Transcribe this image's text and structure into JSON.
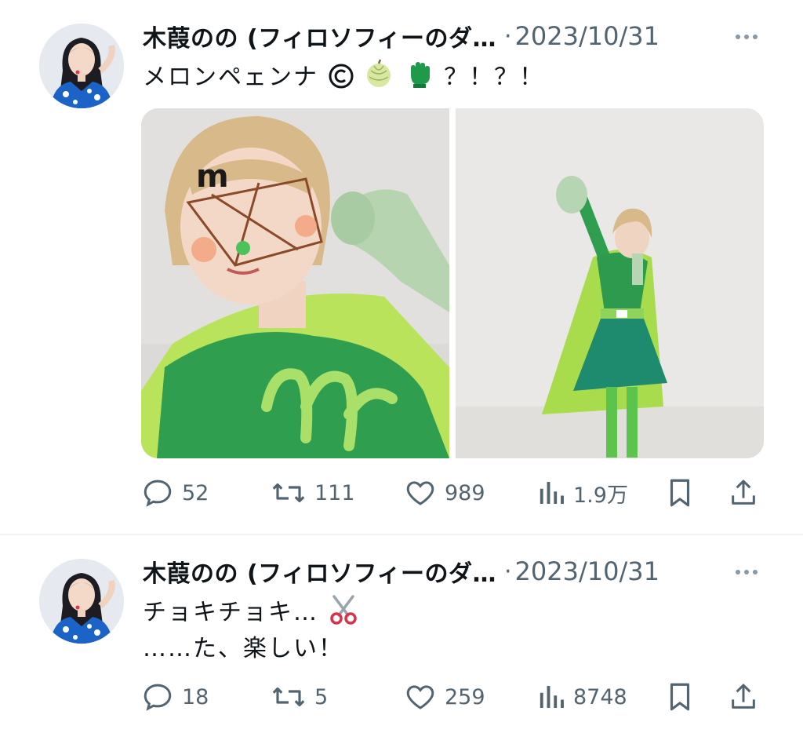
{
  "tweets": [
    {
      "author": "木葭のの (フィロソフィーのダ…",
      "separator": "·",
      "date": "2023/10/31",
      "text_lines": [
        "メロンペェンナ"
      ],
      "text_suffix": "？！？！",
      "stats": {
        "replies": "52",
        "retweets": "111",
        "likes": "989",
        "views": "1.9万"
      },
      "media_count": 2
    },
    {
      "author": "木葭のの (フィロソフィーのダ…",
      "separator": "·",
      "date": "2023/10/31",
      "text_lines": [
        "チョキチョキ…",
        "……た、楽しい！"
      ],
      "stats": {
        "replies": "18",
        "retweets": "5",
        "likes": "259",
        "views": "8748"
      },
      "media_count": 0
    }
  ],
  "colors": {
    "text": "#0f1419",
    "secondary": "#536471",
    "divider": "#eff3f4",
    "suit_green": "#2e9b50",
    "cape_lime": "#a6dc4a"
  },
  "icons": [
    "reply-icon",
    "retweet-icon",
    "like-icon",
    "views-icon",
    "bookmark-icon",
    "share-icon",
    "more-icon",
    "copyright-emoji",
    "melon-emoji",
    "glove-emoji",
    "scissors-emoji"
  ]
}
